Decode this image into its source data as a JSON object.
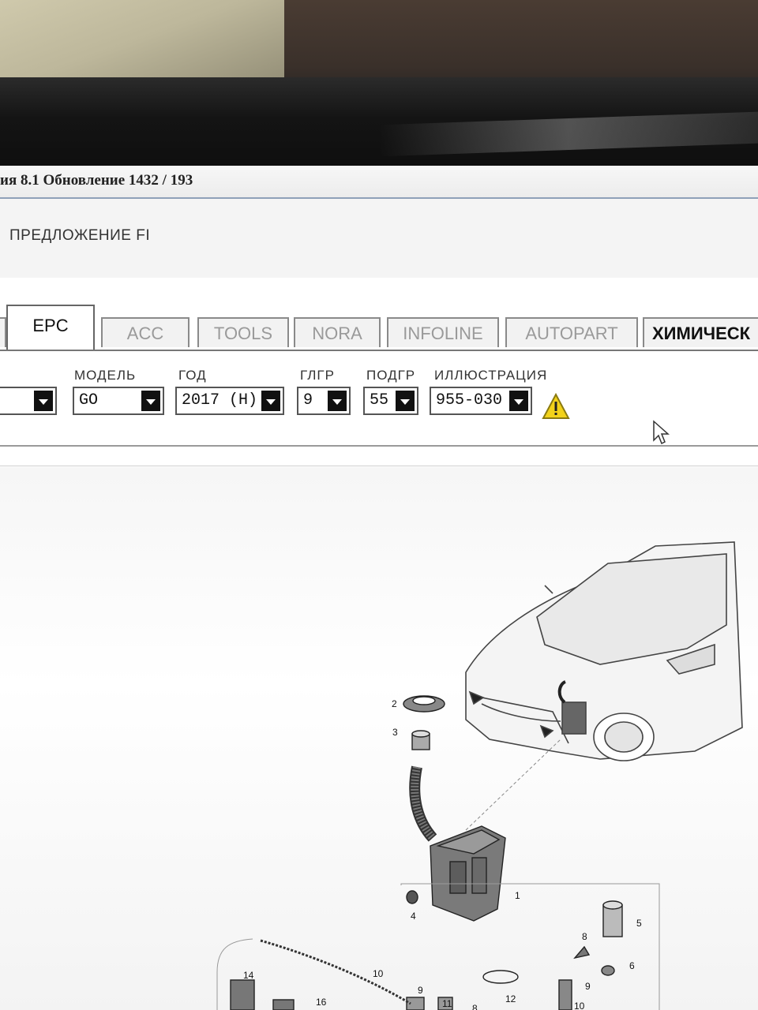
{
  "window": {
    "title": "ия 8.1 Обновление 1432 / 193"
  },
  "toolbar": {
    "offer_label": "ПРЕДЛОЖЕНИЕ FI"
  },
  "tabs": [
    {
      "label": "EPC",
      "active": true
    },
    {
      "label": "ACC",
      "active": false
    },
    {
      "label": "TOOLS",
      "active": false
    },
    {
      "label": "NORA",
      "active": false
    },
    {
      "label": "INFOLINE",
      "active": false
    },
    {
      "label": "AUTOPART",
      "active": false
    },
    {
      "label": "ХИМИЧЕСК",
      "active": false
    }
  ],
  "filters": {
    "brand": {
      "label": "",
      "value": ""
    },
    "model": {
      "label": "МОДЕЛЬ",
      "value": "GO"
    },
    "year": {
      "label": "ГОД",
      "value": "2017 (H)"
    },
    "main_group": {
      "label": "ГЛГР",
      "value": "9"
    },
    "sub_group": {
      "label": "ПОДГР",
      "value": "55"
    },
    "illustration": {
      "label": "ИЛЛЮСТРАЦИЯ",
      "value": "955-030"
    }
  },
  "diagram": {
    "callouts": [
      "1",
      "2",
      "3",
      "4",
      "5",
      "6",
      "8",
      "9",
      "9",
      "10",
      "10",
      "11",
      "12",
      "14",
      "16",
      "8"
    ]
  },
  "colors": {
    "warning": "#f2d21a",
    "tab_border": "#8a8a8a",
    "title_border": "#8fa0b8"
  },
  "icons": {
    "warning": "warning-triangle-icon",
    "cursor": "mouse-pointer-icon",
    "dropdown": "chevron-down-icon"
  }
}
